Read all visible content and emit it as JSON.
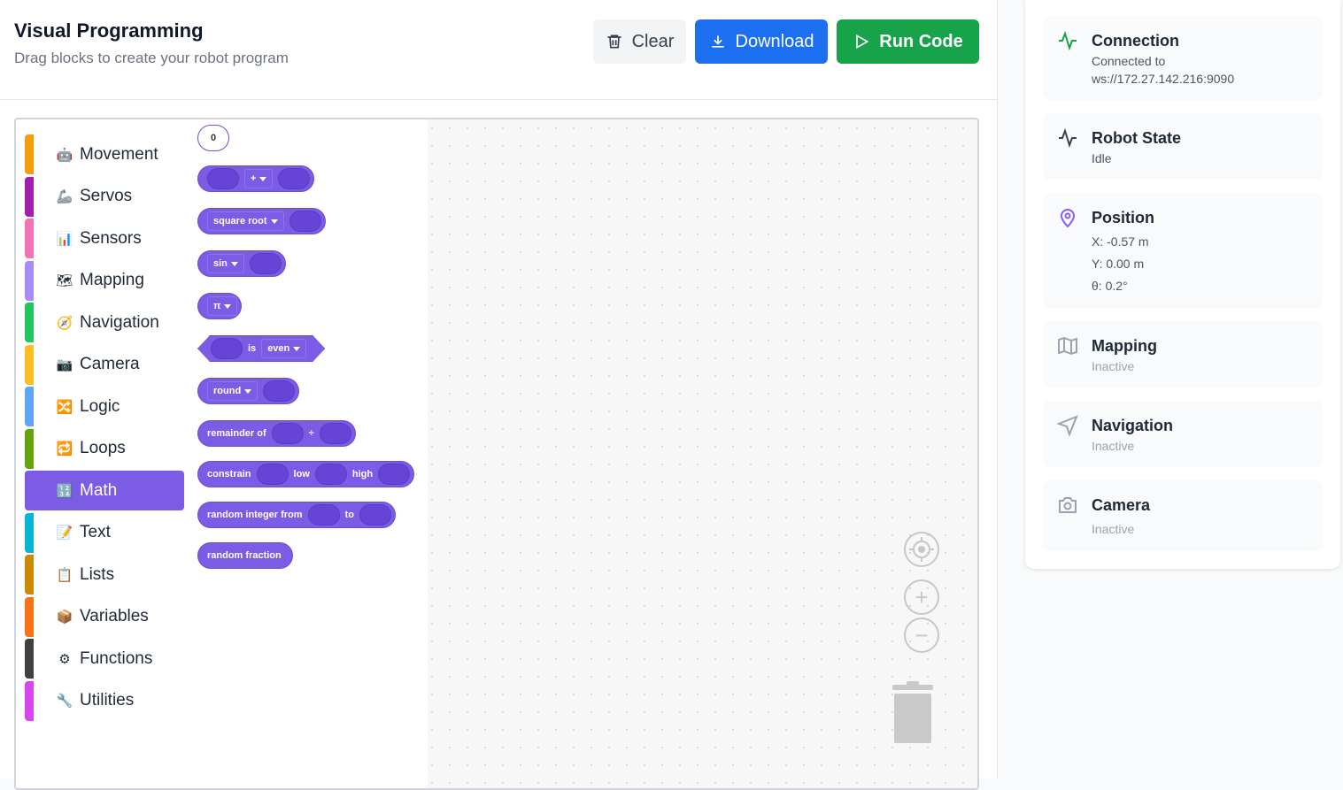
{
  "header": {
    "title": "Visual Programming",
    "subtitle": "Drag blocks to create your robot program",
    "clear_label": "Clear",
    "download_label": "Download",
    "run_label": "Run Code"
  },
  "toolbox": {
    "categories": [
      {
        "label": "Movement",
        "icon": "🤖",
        "color": "#f59e0b"
      },
      {
        "label": "Servos",
        "icon": "🦾",
        "color": "#a21caf"
      },
      {
        "label": "Sensors",
        "icon": "📊",
        "color": "#f472b6"
      },
      {
        "label": "Mapping",
        "icon": "🗺",
        "color": "#a78bfa"
      },
      {
        "label": "Navigation",
        "icon": "🧭",
        "color": "#22c55e"
      },
      {
        "label": "Camera",
        "icon": "📷",
        "color": "#fbbf24"
      },
      {
        "label": "Logic",
        "icon": "🔀",
        "color": "#60a5fa"
      },
      {
        "label": "Loops",
        "icon": "🔁",
        "color": "#65a30d"
      },
      {
        "label": "Math",
        "icon": "🔢",
        "color": "#7c5ce5"
      },
      {
        "label": "Text",
        "icon": "📝",
        "color": "#06b6d4"
      },
      {
        "label": "Lists",
        "icon": "📋",
        "color": "#ca8a04"
      },
      {
        "label": "Variables",
        "icon": "📦",
        "color": "#f97316"
      },
      {
        "label": "Functions",
        "icon": "⚙",
        "color": "#404040"
      },
      {
        "label": "Utilities",
        "icon": "🔧",
        "color": "#d946ef"
      }
    ],
    "selected": "Math"
  },
  "flyout": {
    "number_value": "0",
    "arith_op": "+",
    "single_op": "square root",
    "trig_op": "sin",
    "constant": "π",
    "is_label": "is",
    "property": "even",
    "round_op": "round",
    "remainder_label": "remainder of",
    "divide_symbol": "÷",
    "constrain_label": "constrain",
    "low_label": "low",
    "high_label": "high",
    "random_int_label": "random integer from",
    "to_label": "to",
    "random_fraction_label": "random fraction"
  },
  "status": {
    "connection": {
      "title": "Connection",
      "line1": "Connected to",
      "line2": "ws://172.27.142.216:9090",
      "icon": "activity-icon",
      "color": "#16a34a"
    },
    "robot_state": {
      "title": "Robot State",
      "value": "Idle",
      "icon": "activity-icon"
    },
    "position": {
      "title": "Position",
      "x": "X: -0.57 m",
      "y": "Y: 0.00 m",
      "theta": "θ: 0.2°",
      "icon": "map-pin-icon",
      "color": "#8b5cf6"
    },
    "mapping": {
      "title": "Mapping",
      "value": "Inactive",
      "icon": "map-icon"
    },
    "navigation": {
      "title": "Navigation",
      "value": "Inactive",
      "icon": "navigation-icon"
    },
    "camera": {
      "title": "Camera",
      "value": "Inactive",
      "icon": "camera-icon"
    }
  }
}
